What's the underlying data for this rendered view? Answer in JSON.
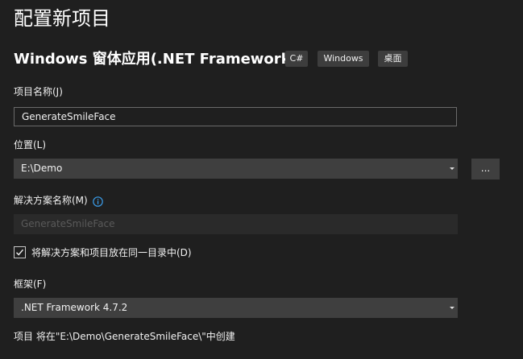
{
  "page_title": "配置新项目",
  "template": {
    "title": "Windows 窗体应用(.NET Framework)",
    "tags": [
      "C#",
      "Windows",
      "桌面"
    ]
  },
  "project_name": {
    "label": "项目名称(J)",
    "value": "GenerateSmileFace"
  },
  "location": {
    "label": "位置(L)",
    "value": "E:\\Demo",
    "browse_label": "..."
  },
  "solution_name": {
    "label": "解决方案名称(M)",
    "value": "GenerateSmileFace",
    "info_icon": "info-icon",
    "enabled": false
  },
  "same_directory": {
    "label": "将解决方案和项目放在同一目录中(D)",
    "checked": true
  },
  "framework": {
    "label": "框架(F)",
    "value": ".NET Framework 4.7.2"
  },
  "footer": {
    "text": "项目 将在\"E:\\Demo\\GenerateSmileFace\\\"中创建"
  },
  "colors": {
    "background": "#1f1f1f",
    "input_fill": "#3f3f3f",
    "tag_fill": "#3d3d3d",
    "info_accent": "#3b9ce9",
    "text": "#f1f1f1",
    "disabled_text": "#5a5a5a"
  }
}
